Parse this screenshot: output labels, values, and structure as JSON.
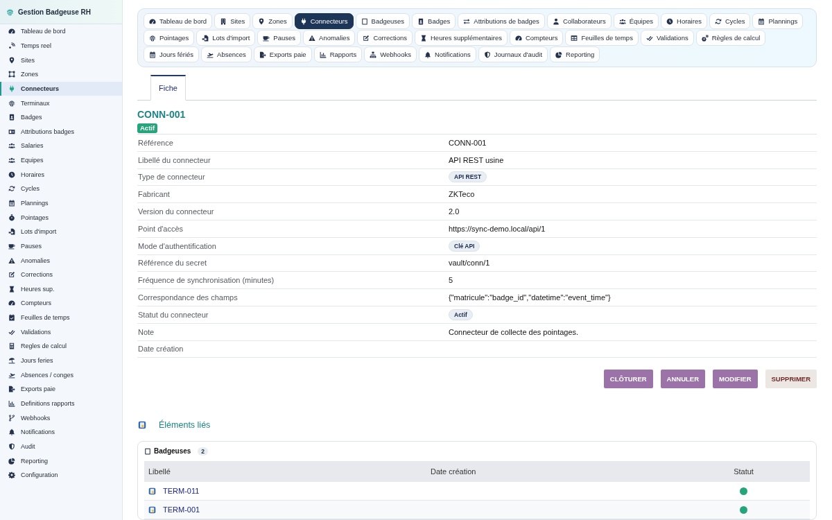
{
  "sidebar": {
    "title": "Gestion Badgeuse RH",
    "items": [
      {
        "label": "Tableau de bord",
        "selected": false
      },
      {
        "label": "Temps reel",
        "selected": false
      },
      {
        "label": "Sites",
        "selected": false
      },
      {
        "label": "Zones",
        "selected": false
      },
      {
        "label": "Connecteurs",
        "selected": true
      },
      {
        "label": "Terminaux",
        "selected": false
      },
      {
        "label": "Badges",
        "selected": false
      },
      {
        "label": "Attributions badges",
        "selected": false
      },
      {
        "label": "Salaries",
        "selected": false
      },
      {
        "label": "Equipes",
        "selected": false
      },
      {
        "label": "Horaires",
        "selected": false
      },
      {
        "label": "Cycles",
        "selected": false
      },
      {
        "label": "Plannings",
        "selected": false
      },
      {
        "label": "Pointages",
        "selected": false
      },
      {
        "label": "Lots d'import",
        "selected": false
      },
      {
        "label": "Pauses",
        "selected": false
      },
      {
        "label": "Anomalies",
        "selected": false
      },
      {
        "label": "Corrections",
        "selected": false
      },
      {
        "label": "Heures sup.",
        "selected": false
      },
      {
        "label": "Compteurs",
        "selected": false
      },
      {
        "label": "Feuilles de temps",
        "selected": false
      },
      {
        "label": "Validations",
        "selected": false
      },
      {
        "label": "Regles de calcul",
        "selected": false
      },
      {
        "label": "Jours feries",
        "selected": false
      },
      {
        "label": "Absences / conges",
        "selected": false
      },
      {
        "label": "Exports paie",
        "selected": false
      },
      {
        "label": "Definitions rapports",
        "selected": false
      },
      {
        "label": "Webhooks",
        "selected": false
      },
      {
        "label": "Notifications",
        "selected": false
      },
      {
        "label": "Audit",
        "selected": false
      },
      {
        "label": "Reporting",
        "selected": false
      },
      {
        "label": "Configuration",
        "selected": false
      }
    ]
  },
  "module_tabs": [
    [
      {
        "label": "Tableau de bord",
        "selected": false
      },
      {
        "label": "Sites",
        "selected": false
      },
      {
        "label": "Zones",
        "selected": false
      },
      {
        "label": "Connecteurs",
        "selected": true
      },
      {
        "label": "Badgeuses",
        "selected": false
      },
      {
        "label": "Badges",
        "selected": false
      },
      {
        "label": "Attributions de badges",
        "selected": false
      },
      {
        "label": "Collaborateurs",
        "selected": false
      },
      {
        "label": "Équipes",
        "selected": false
      },
      {
        "label": "Horaires",
        "selected": false
      },
      {
        "label": "Cycles",
        "selected": false
      },
      {
        "label": "Plannings",
        "selected": false
      }
    ],
    [
      {
        "label": "Pointages",
        "selected": false
      },
      {
        "label": "Lots d'import",
        "selected": false
      },
      {
        "label": "Pauses",
        "selected": false
      },
      {
        "label": "Anomalies",
        "selected": false
      },
      {
        "label": "Corrections",
        "selected": false
      },
      {
        "label": "Heures supplémentaires",
        "selected": false
      },
      {
        "label": "Compteurs",
        "selected": false
      },
      {
        "label": "Feuilles de temps",
        "selected": false
      },
      {
        "label": "Validations",
        "selected": false
      },
      {
        "label": "Règles de calcul",
        "selected": false
      }
    ],
    [
      {
        "label": "Jours fériés",
        "selected": false
      },
      {
        "label": "Absences",
        "selected": false
      },
      {
        "label": "Exports paie",
        "selected": false
      },
      {
        "label": "Rapports",
        "selected": false
      },
      {
        "label": "Webhooks",
        "selected": false
      },
      {
        "label": "Notifications",
        "selected": false
      },
      {
        "label": "Journaux d'audit",
        "selected": false
      },
      {
        "label": "Reporting",
        "selected": false
      }
    ]
  ],
  "record_tabs": [
    {
      "label": "Fiche",
      "selected": true
    }
  ],
  "record": {
    "title": "CONN-001",
    "status": "Actif",
    "fields": [
      {
        "label": "Référence",
        "value": "CONN-001",
        "kind": "text"
      },
      {
        "label": "Libellé du connecteur",
        "value": "API REST usine",
        "kind": "text"
      },
      {
        "label": "Type de connecteur",
        "value": "API REST",
        "kind": "pill"
      },
      {
        "label": "Fabricant",
        "value": "ZKTeco",
        "kind": "text"
      },
      {
        "label": "Version du connecteur",
        "value": "2.0",
        "kind": "text"
      },
      {
        "label": "Point d'accès",
        "value": "https://sync-demo.local/api/1",
        "kind": "text"
      },
      {
        "label": "Mode d'authentification",
        "value": "Clé API",
        "kind": "pill"
      },
      {
        "label": "Référence du secret",
        "value": "vault/conn/1",
        "kind": "text"
      },
      {
        "label": "Fréquence de synchronisation (minutes)",
        "value": "5",
        "kind": "text"
      },
      {
        "label": "Correspondance des champs",
        "value": "{\"matricule\":\"badge_id\",\"datetime\":\"event_time\"}",
        "kind": "text"
      },
      {
        "label": "Statut du connecteur",
        "value": "Actif",
        "kind": "pill"
      },
      {
        "label": "Note",
        "value": "Connecteur de collecte des pointages.",
        "kind": "text"
      },
      {
        "label": "Date création"
      }
    ]
  },
  "actions": [
    {
      "label": "CLÔTURER",
      "kind": "primary"
    },
    {
      "label": "ANNULER",
      "kind": "primary"
    },
    {
      "label": "MODIFIER",
      "kind": "primary"
    },
    {
      "label": "SUPPRIMER",
      "kind": "danger"
    }
  ],
  "linked": {
    "title": "Éléments liés",
    "sections": [
      {
        "title": "Badgeuses",
        "count": "2",
        "columns": [
          "Libellé",
          "Date création",
          "Statut"
        ],
        "rows": [
          {
            "label": "TERM-011",
            "color": "#27a57a"
          },
          {
            "label": "TERM-001",
            "color": "#27a57a"
          }
        ]
      }
    ]
  }
}
